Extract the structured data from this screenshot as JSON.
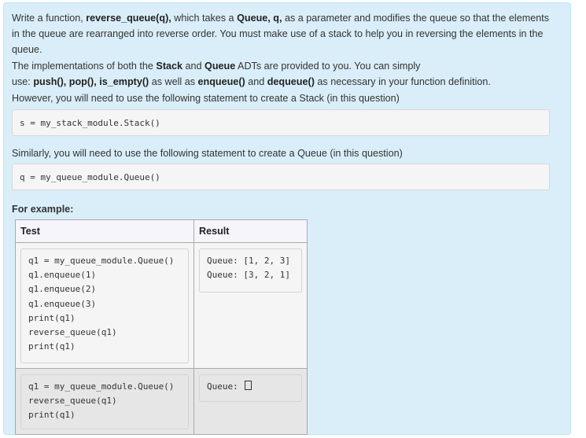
{
  "question": {
    "paragraph1": {
      "t1": "Write a function, ",
      "b1": "reverse_queue(q),",
      "t2": " which takes a ",
      "b2": "Queue, q,",
      "t3": " as a parameter and modifies the queue so that the elements in the queue are rearranged into reverse order. You must make use of a stack to help you in reversing the elements in the queue."
    },
    "paragraph2": {
      "t1": "The implementations of both the ",
      "b1": "Stack",
      "t2": " and ",
      "b2": "Queue",
      "t3": " ADTs are provided to you. You can simply",
      "t4": "use: ",
      "b3": "push(), pop(), is_empty()",
      "t5": " as well as ",
      "b4": "enqueue()",
      "t6": " and ",
      "b5": "dequeue()",
      "t7": " as necessary in your function definition."
    },
    "paragraph3": "However, you will need to use the following statement to create a Stack (in this question)",
    "stack_code": "s = my_stack_module.Stack()",
    "paragraph4": "Similarly, you will need to use the following statement to create a Queue (in this question)",
    "queue_code": "q = my_queue_module.Queue()",
    "example_heading": "For example:"
  },
  "example_table": {
    "headers": [
      "Test",
      "Result"
    ],
    "rows": [
      {
        "test": [
          "q1 = my_queue_module.Queue()",
          "q1.enqueue(1)",
          "q1.enqueue(2)",
          "q1.enqueue(3)",
          "print(q1)",
          "reverse_queue(q1)",
          "print(q1)"
        ],
        "result": [
          "Queue: [1, 2, 3]",
          "Queue: [3, 2, 1]"
        ]
      },
      {
        "test": [
          "q1 = my_queue_module.Queue()",
          "reverse_queue(q1)",
          "print(q1)"
        ],
        "result": [
          "Queue: "
        ],
        "result_suffix_icon": "empty-list-box-icon"
      }
    ]
  }
}
